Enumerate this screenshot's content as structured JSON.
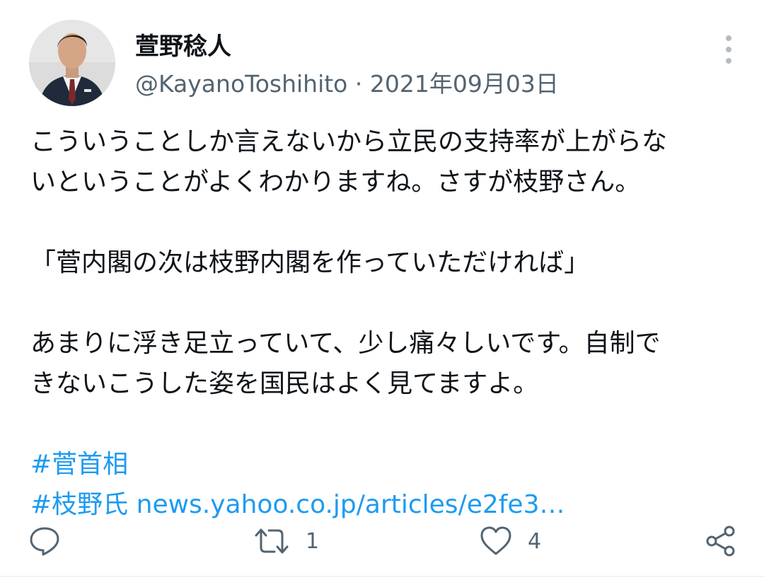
{
  "author": {
    "display_name": "萱野稔人",
    "handle": "@KayanoToshihito",
    "separator": "·",
    "date": "2021年09月03日"
  },
  "tweet": {
    "lines": [
      "こういうことしか言えないから立民の支持率が上がらな",
      "いということがよくわかりますね。さすが枝野さん。",
      "",
      "「菅内閣の次は枝野内閣を作っていただければ」",
      "",
      "あまりに浮き足立っていて、少し痛々しいです。自制で",
      "きないこうした姿を国民はよく見てますよ。",
      ""
    ],
    "hashtag_1": "#菅首相",
    "hashtag_2": "#枝野氏",
    "link_text": "news.yahoo.co.jp/articles/e2fe3…"
  },
  "actions": {
    "reply_icon": "reply-icon",
    "retweet_icon": "retweet-icon",
    "retweet_count": "1",
    "like_icon": "heart-icon",
    "like_count": "4",
    "share_icon": "share-icon"
  },
  "colors": {
    "text": "#0f1419",
    "secondary": "#536471",
    "link": "#1d9bf0"
  }
}
